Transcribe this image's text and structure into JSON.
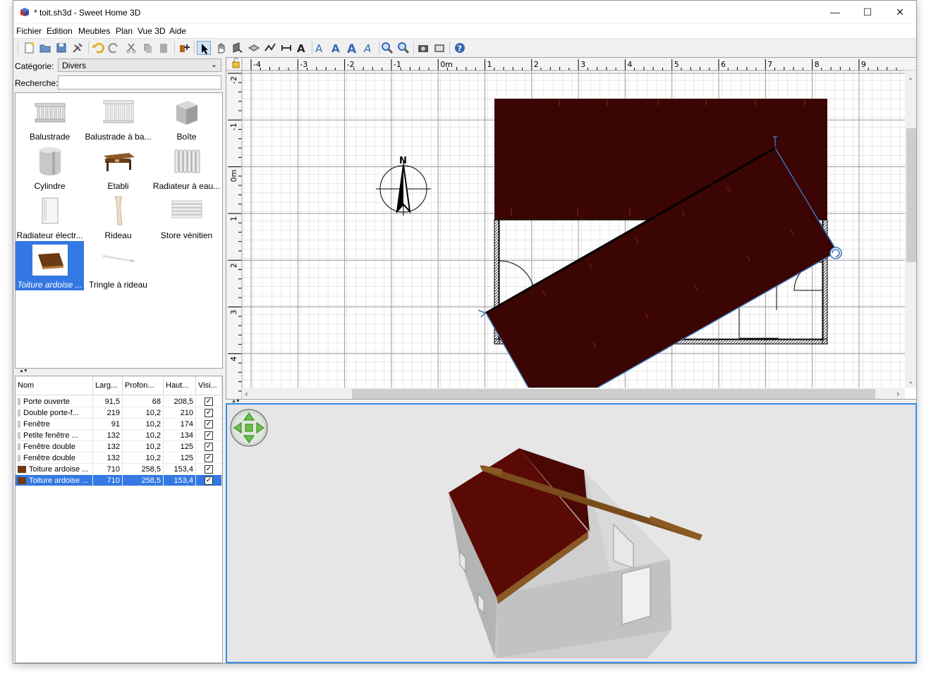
{
  "window": {
    "title": "* toit.sh3d - Sweet Home 3D",
    "controls": {
      "minimize": "—",
      "maximize": "☐",
      "close": "✕"
    }
  },
  "menu": [
    "Fichier",
    "Edition",
    "Meubles",
    "Plan",
    "Vue 3D",
    "Aide"
  ],
  "toolbar": {
    "icons": [
      "new-icon",
      "open-icon",
      "save-icon",
      "preferences-icon",
      "undo-icon",
      "redo-icon",
      "cut-icon",
      "copy-icon",
      "paste-icon",
      "add-furniture-icon",
      "select-icon",
      "pan-icon",
      "create-walls-icon",
      "create-rooms-icon",
      "create-polylines-icon",
      "create-dimensions-icon",
      "create-labels-icon",
      "text-style-icon",
      "text-bold-icon",
      "text-bigger-icon",
      "text-italic-icon",
      "zoom-in-icon",
      "zoom-out-icon",
      "photo-icon",
      "video-icon",
      "help-icon"
    ]
  },
  "catalog": {
    "category_label": "Catégorie:",
    "category_value": "Divers",
    "search_label": "Recherche:",
    "search_value": "",
    "items": [
      {
        "label": "Balustrade",
        "selected": false
      },
      {
        "label": "Balustrade à ba...",
        "selected": false
      },
      {
        "label": "Boîte",
        "selected": false
      },
      {
        "label": "Cylindre",
        "selected": false
      },
      {
        "label": "Etabli",
        "selected": false
      },
      {
        "label": "Radiateur à eau...",
        "selected": false
      },
      {
        "label": "Radiateur électr...",
        "selected": false
      },
      {
        "label": "Rideau",
        "selected": false
      },
      {
        "label": "Store vénitien",
        "selected": false
      },
      {
        "label": "Toiture ardoise ...",
        "selected": true
      },
      {
        "label": "Tringle à rideau",
        "selected": false
      }
    ]
  },
  "furniture_table": {
    "columns": [
      "Nom",
      "Larg...",
      "Profon...",
      "Haut...",
      "Visi..."
    ],
    "rows": [
      {
        "name": "Porte ouverte",
        "width": "91,5",
        "depth": "68",
        "height": "208,5",
        "visible": true,
        "selected": false
      },
      {
        "name": "Double porte-f...",
        "width": "219",
        "depth": "10,2",
        "height": "210",
        "visible": true,
        "selected": false
      },
      {
        "name": "Fenêtre",
        "width": "91",
        "depth": "10,2",
        "height": "174",
        "visible": true,
        "selected": false
      },
      {
        "name": "Petite fenêtre ...",
        "width": "132",
        "depth": "10,2",
        "height": "134",
        "visible": true,
        "selected": false
      },
      {
        "name": "Fenêtre double",
        "width": "132",
        "depth": "10,2",
        "height": "125",
        "visible": true,
        "selected": false
      },
      {
        "name": "Fenêtre double",
        "width": "132",
        "depth": "10,2",
        "height": "125",
        "visible": true,
        "selected": false
      },
      {
        "name": "Toiture ardoise ...",
        "width": "710",
        "depth": "258,5",
        "height": "153,4",
        "visible": true,
        "selected": false
      },
      {
        "name": "Toiture ardoise ...",
        "width": "710",
        "depth": "258,5",
        "height": "153,4",
        "visible": true,
        "selected": true
      }
    ]
  },
  "plan": {
    "ruler_x": [
      "-4",
      "-3",
      "-2",
      "-1",
      "0m",
      "1",
      "2",
      "3",
      "4",
      "5",
      "6",
      "7",
      "8",
      "9"
    ],
    "ruler_y": [
      "-2",
      "-1",
      "0m",
      "1",
      "2",
      "3",
      "4"
    ],
    "compass_label": "N"
  },
  "colors": {
    "roof": "#3a0503",
    "roof3d": "#5a0a05",
    "selection": "#3478e3",
    "accent": "#3a8ee6"
  }
}
